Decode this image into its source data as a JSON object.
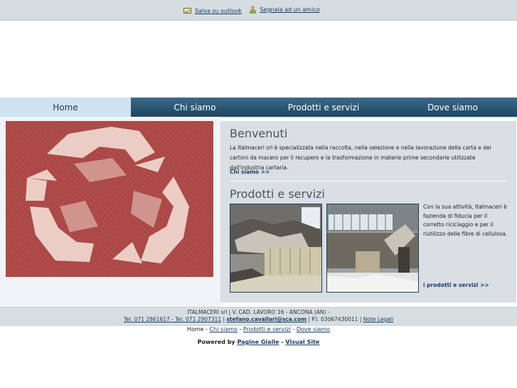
{
  "toplinks": {
    "save_outlook": "Salva su outlook",
    "tell_friend": "Segnala ad un amico"
  },
  "nav": {
    "tabs": [
      {
        "label": "Home"
      },
      {
        "label": "Chi siamo"
      },
      {
        "label": "Prodotti e servizi"
      },
      {
        "label": "Dove siamo"
      }
    ]
  },
  "welcome": {
    "title": "Benvenuti",
    "text": "La Italmaceri srl è specializzata nella raccolta, nella selezione e nella lavorazione della carta e dei cartoni da macero per il recupero e la trasformazione in materie prime secondarie utilizzate dall'industria cartaria.",
    "more_link": "Chi siamo >>"
  },
  "products": {
    "title": "Prodotti e servizi",
    "text": "Con la sua attività, Italmaceri è fazienda di fiducia per il corretto riciclaggio e per il riutilizzo delle fibre di cellulosa.",
    "more_link": "i prodotti e servizi >>"
  },
  "footer": {
    "address": "ITALMACERI srl | V. CAD. LAVORO 16 - ANCONA (AN) -",
    "tel": "Tel. 071 2861617 - Tel. 071 2907311",
    "email": "stefano.cavallari@sca.com",
    "piva": "P.I. 03067430011",
    "legal": "Note Legali",
    "sep": "|"
  },
  "bottom_links": {
    "home": "Home",
    "chi_siamo": "Chi siamo",
    "prodotti": "Prodotti e servizi",
    "dove": "Dove siamo",
    "dash": "-"
  },
  "powered": {
    "label": "Powered by",
    "pagine": "Pagine Gialle",
    "dash": "-",
    "visual": "Visual Site"
  },
  "colors": {
    "nav": "#2b5672",
    "nav_active": "#cfe3f0",
    "hero": "#b04c4a",
    "panel": "#d9dfe3",
    "link": "#1e3e66"
  },
  "icons": [
    "outlook-icon",
    "tell-friend-icon",
    "recycle-icon"
  ]
}
